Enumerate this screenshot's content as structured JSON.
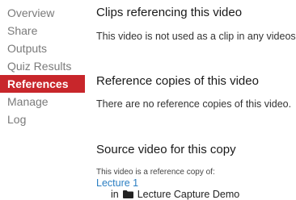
{
  "sidebar": {
    "items": [
      {
        "label": "Overview"
      },
      {
        "label": "Share"
      },
      {
        "label": "Outputs"
      },
      {
        "label": "Quiz Results"
      },
      {
        "label": "References",
        "active": true
      },
      {
        "label": "Manage"
      },
      {
        "label": "Log"
      }
    ]
  },
  "clips": {
    "title": "Clips referencing this video",
    "text": "This video is not used as a clip in any videos."
  },
  "reference_copies": {
    "title": "Reference copies of this video",
    "text": "There are no reference copies of this video."
  },
  "source": {
    "title": "Source video for this copy",
    "note": "This video is a reference copy of:",
    "link": "Lecture 1",
    "in_prefix": "in",
    "folder_icon": "folder-icon",
    "folder_name": "Lecture Capture Demo"
  },
  "colors": {
    "active_bg": "#c8262b",
    "link": "#2a7ec2"
  }
}
